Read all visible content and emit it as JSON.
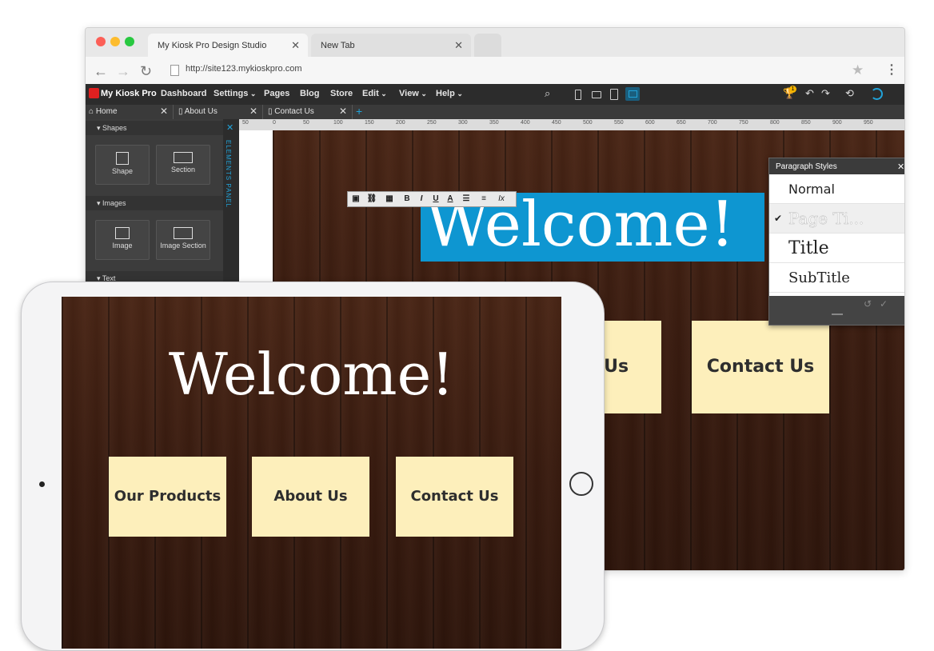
{
  "browser": {
    "tabs": [
      {
        "title": "My Kiosk Pro Design Studio"
      },
      {
        "title": "New Tab"
      }
    ],
    "url": "http://site123.mykioskpro.com"
  },
  "app": {
    "logo": "My Kiosk Pro",
    "menu": [
      "Dashboard",
      "Settings",
      "Pages",
      "Blog",
      "Store",
      "Edit",
      "View",
      "Help"
    ],
    "menu_dropdown_caret": "⌄",
    "notification_count": "1"
  },
  "page_tabs": [
    "Home",
    "About Us",
    "Contact Us"
  ],
  "elements_panel": {
    "vertical_label": "ELEMENTS PANEL",
    "sections": [
      {
        "title": "Shapes",
        "items": [
          "Shape",
          "Section"
        ]
      },
      {
        "title": "Images",
        "items": [
          "Image",
          "Image Section"
        ]
      },
      {
        "title": "Text",
        "items": []
      }
    ]
  },
  "ruler": [
    "50",
    "0",
    "50",
    "100",
    "150",
    "200",
    "250",
    "300",
    "350",
    "400",
    "450",
    "500",
    "550",
    "600",
    "650",
    "700",
    "750",
    "800",
    "850",
    "900",
    "950"
  ],
  "editor_toolbar": {
    "bold": "B",
    "italic": "I",
    "underline": "U",
    "font_color": "A",
    "clear": "Ix"
  },
  "canvas": {
    "heading": "Welcome!",
    "buttons": [
      "Contact Us"
    ],
    "partial_button": "t Us"
  },
  "paragraph_styles": {
    "title": "Paragraph Styles",
    "items": [
      "Normal",
      "Page Ti...",
      "Title",
      "SubTitle"
    ],
    "selected": "Page Ti..."
  },
  "ipad": {
    "heading": "Welcome!",
    "buttons": [
      "Our Products",
      "About Us",
      "Contact Us"
    ]
  },
  "colors": {
    "highlight": "#0e96d1",
    "button_bg": "#fdefbb",
    "toolbar_bg": "#2c2c2c",
    "accent": "#21a3d9"
  }
}
